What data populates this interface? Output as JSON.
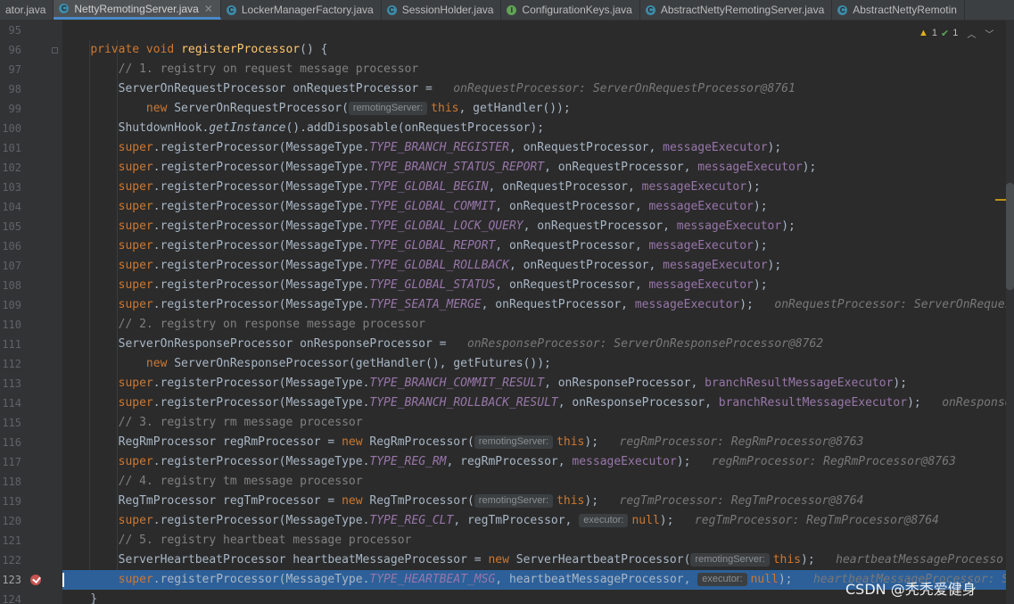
{
  "tabs": [
    {
      "label": "ator.java",
      "icon": "none",
      "close": false
    },
    {
      "label": "NettyRemotingServer.java",
      "icon": "class",
      "close": true,
      "active": true
    },
    {
      "label": "LockerManagerFactory.java",
      "icon": "class",
      "close": false
    },
    {
      "label": "SessionHolder.java",
      "icon": "class",
      "close": false
    },
    {
      "label": "ConfigurationKeys.java",
      "icon": "interface",
      "close": false
    },
    {
      "label": "AbstractNettyRemotingServer.java",
      "icon": "class",
      "close": false
    },
    {
      "label": "AbstractNettyRemotin",
      "icon": "class",
      "close": false
    }
  ],
  "inspection": {
    "warnings": "1",
    "ok": "1"
  },
  "current_line": "123",
  "watermark": "CSDN @秃秃爱健身",
  "colors": {
    "background": "#2b2b2b",
    "keyword": "#cc7832",
    "method": "#ffc66d",
    "constant": "#9876aa",
    "comment": "#808080",
    "selection": "#2d6099",
    "breakpoint": "#c75450"
  },
  "lines": [
    {
      "n": "95",
      "segs": []
    },
    {
      "n": "96",
      "segs": [
        [
          "    ",
          ""
        ],
        [
          "private void ",
          "kw"
        ],
        [
          "registerProcessor",
          "fn"
        ],
        [
          "() {",
          ""
        ]
      ],
      "fold": true
    },
    {
      "n": "97",
      "segs": [
        [
          "        ",
          ""
        ],
        [
          "// 1. registry on request message processor",
          "cm"
        ]
      ]
    },
    {
      "n": "98",
      "segs": [
        [
          "        ServerOnRequestProcessor onRequestProcessor = ",
          ""
        ],
        [
          "  onRequestProcessor: ServerOnRequestProcessor@8761",
          "hint"
        ]
      ]
    },
    {
      "n": "99",
      "segs": [
        [
          "            ",
          ""
        ],
        [
          "new ",
          "kw"
        ],
        [
          "ServerOnRequestProcessor(",
          ""
        ],
        [
          "remotingServer:",
          "chip"
        ],
        [
          "this",
          "kw"
        ],
        [
          ", getHandler());",
          ""
        ]
      ]
    },
    {
      "n": "100",
      "segs": [
        [
          "        ShutdownHook.",
          ""
        ],
        [
          "getInstance",
          "it"
        ],
        [
          "().addDisposable(onRequestProcessor);",
          ""
        ]
      ]
    },
    {
      "n": "101",
      "segs": [
        [
          "        ",
          ""
        ],
        [
          "super",
          "kw"
        ],
        [
          ".registerProcessor(MessageType.",
          ""
        ],
        [
          "TYPE_BRANCH_REGISTER",
          "st"
        ],
        [
          ", onRequestProcessor, ",
          ""
        ],
        [
          "messageExecutor",
          "va"
        ],
        [
          ");",
          ""
        ]
      ]
    },
    {
      "n": "102",
      "segs": [
        [
          "        ",
          ""
        ],
        [
          "super",
          "kw"
        ],
        [
          ".registerProcessor(MessageType.",
          ""
        ],
        [
          "TYPE_BRANCH_STATUS_REPORT",
          "st"
        ],
        [
          ", onRequestProcessor, ",
          ""
        ],
        [
          "messageExecutor",
          "va"
        ],
        [
          ");",
          ""
        ]
      ]
    },
    {
      "n": "103",
      "segs": [
        [
          "        ",
          ""
        ],
        [
          "super",
          "kw"
        ],
        [
          ".registerProcessor(MessageType.",
          ""
        ],
        [
          "TYPE_GLOBAL_BEGIN",
          "st"
        ],
        [
          ", onRequestProcessor, ",
          ""
        ],
        [
          "messageExecutor",
          "va"
        ],
        [
          ");",
          ""
        ]
      ]
    },
    {
      "n": "104",
      "segs": [
        [
          "        ",
          ""
        ],
        [
          "super",
          "kw"
        ],
        [
          ".registerProcessor(MessageType.",
          ""
        ],
        [
          "TYPE_GLOBAL_COMMIT",
          "st"
        ],
        [
          ", onRequestProcessor, ",
          ""
        ],
        [
          "messageExecutor",
          "va"
        ],
        [
          ");",
          ""
        ]
      ]
    },
    {
      "n": "105",
      "segs": [
        [
          "        ",
          ""
        ],
        [
          "super",
          "kw"
        ],
        [
          ".registerProcessor(MessageType.",
          ""
        ],
        [
          "TYPE_GLOBAL_LOCK_QUERY",
          "st"
        ],
        [
          ", onRequestProcessor, ",
          ""
        ],
        [
          "messageExecutor",
          "va"
        ],
        [
          ");",
          ""
        ]
      ]
    },
    {
      "n": "106",
      "segs": [
        [
          "        ",
          ""
        ],
        [
          "super",
          "kw"
        ],
        [
          ".registerProcessor(MessageType.",
          ""
        ],
        [
          "TYPE_GLOBAL_REPORT",
          "st"
        ],
        [
          ", onRequestProcessor, ",
          ""
        ],
        [
          "messageExecutor",
          "va"
        ],
        [
          ");",
          ""
        ]
      ]
    },
    {
      "n": "107",
      "segs": [
        [
          "        ",
          ""
        ],
        [
          "super",
          "kw"
        ],
        [
          ".registerProcessor(MessageType.",
          ""
        ],
        [
          "TYPE_GLOBAL_ROLLBACK",
          "st"
        ],
        [
          ", onRequestProcessor, ",
          ""
        ],
        [
          "messageExecutor",
          "va"
        ],
        [
          ");",
          ""
        ]
      ]
    },
    {
      "n": "108",
      "segs": [
        [
          "        ",
          ""
        ],
        [
          "super",
          "kw"
        ],
        [
          ".registerProcessor(MessageType.",
          ""
        ],
        [
          "TYPE_GLOBAL_STATUS",
          "st"
        ],
        [
          ", onRequestProcessor, ",
          ""
        ],
        [
          "messageExecutor",
          "va"
        ],
        [
          ");",
          ""
        ]
      ]
    },
    {
      "n": "109",
      "segs": [
        [
          "        ",
          ""
        ],
        [
          "super",
          "kw"
        ],
        [
          ".registerProcessor(MessageType.",
          ""
        ],
        [
          "TYPE_SEATA_MERGE",
          "st"
        ],
        [
          ", onRequestProcessor, ",
          ""
        ],
        [
          "messageExecutor",
          "va"
        ],
        [
          ");",
          ""
        ],
        [
          "   onRequestProcessor: ServerOnReques",
          "hint"
        ]
      ]
    },
    {
      "n": "110",
      "segs": [
        [
          "        ",
          ""
        ],
        [
          "// 2. registry on response message processor",
          "cm"
        ]
      ]
    },
    {
      "n": "111",
      "segs": [
        [
          "        ServerOnResponseProcessor onResponseProcessor = ",
          ""
        ],
        [
          "  onResponseProcessor: ServerOnResponseProcessor@8762",
          "hint"
        ]
      ]
    },
    {
      "n": "112",
      "segs": [
        [
          "            ",
          ""
        ],
        [
          "new ",
          "kw"
        ],
        [
          "ServerOnResponseProcessor(getHandler(), getFutures());",
          ""
        ]
      ]
    },
    {
      "n": "113",
      "segs": [
        [
          "        ",
          ""
        ],
        [
          "super",
          "kw"
        ],
        [
          ".registerProcessor(MessageType.",
          ""
        ],
        [
          "TYPE_BRANCH_COMMIT_RESULT",
          "st"
        ],
        [
          ", onResponseProcessor, ",
          ""
        ],
        [
          "branchResultMessageExecutor",
          "va"
        ],
        [
          ");",
          ""
        ]
      ]
    },
    {
      "n": "114",
      "segs": [
        [
          "        ",
          ""
        ],
        [
          "super",
          "kw"
        ],
        [
          ".registerProcessor(MessageType.",
          ""
        ],
        [
          "TYPE_BRANCH_ROLLBACK_RESULT",
          "st"
        ],
        [
          ", onResponseProcessor, ",
          ""
        ],
        [
          "branchResultMessageExecutor",
          "va"
        ],
        [
          ");",
          ""
        ],
        [
          "   onResponseI",
          "hint"
        ]
      ]
    },
    {
      "n": "115",
      "segs": [
        [
          "        ",
          ""
        ],
        [
          "// 3. registry rm message processor",
          "cm"
        ]
      ]
    },
    {
      "n": "116",
      "segs": [
        [
          "        RegRmProcessor regRmProcessor = ",
          ""
        ],
        [
          "new ",
          "kw"
        ],
        [
          "RegRmProcessor(",
          ""
        ],
        [
          "remotingServer:",
          "chip"
        ],
        [
          "this",
          "kw"
        ],
        [
          ");",
          ""
        ],
        [
          "   regRmProcessor: RegRmProcessor@8763",
          "hint"
        ]
      ]
    },
    {
      "n": "117",
      "segs": [
        [
          "        ",
          ""
        ],
        [
          "super",
          "kw"
        ],
        [
          ".registerProcessor(MessageType.",
          ""
        ],
        [
          "TYPE_REG_RM",
          "st"
        ],
        [
          ", regRmProcessor, ",
          ""
        ],
        [
          "messageExecutor",
          "va"
        ],
        [
          ");",
          ""
        ],
        [
          "   regRmProcessor: RegRmProcessor@8763",
          "hint"
        ]
      ]
    },
    {
      "n": "118",
      "segs": [
        [
          "        ",
          ""
        ],
        [
          "// 4. registry tm message processor",
          "cm"
        ]
      ]
    },
    {
      "n": "119",
      "segs": [
        [
          "        RegTmProcessor regTmProcessor = ",
          ""
        ],
        [
          "new ",
          "kw"
        ],
        [
          "RegTmProcessor(",
          ""
        ],
        [
          "remotingServer:",
          "chip"
        ],
        [
          "this",
          "kw"
        ],
        [
          ");",
          ""
        ],
        [
          "   regTmProcessor: RegTmProcessor@8764",
          "hint"
        ]
      ]
    },
    {
      "n": "120",
      "segs": [
        [
          "        ",
          ""
        ],
        [
          "super",
          "kw"
        ],
        [
          ".registerProcessor(MessageType.",
          ""
        ],
        [
          "TYPE_REG_CLT",
          "st"
        ],
        [
          ", regTmProcessor, ",
          ""
        ],
        [
          "executor:",
          "chip"
        ],
        [
          "null",
          "kw"
        ],
        [
          ");",
          ""
        ],
        [
          "   regTmProcessor: RegTmProcessor@8764",
          "hint"
        ]
      ]
    },
    {
      "n": "121",
      "segs": [
        [
          "        ",
          ""
        ],
        [
          "// 5. registry heartbeat message processor",
          "cm"
        ]
      ]
    },
    {
      "n": "122",
      "segs": [
        [
          "        ServerHeartbeatProcessor heartbeatMessageProcessor = ",
          ""
        ],
        [
          "new ",
          "kw"
        ],
        [
          "ServerHeartbeatProcessor(",
          ""
        ],
        [
          "remotingServer:",
          "chip"
        ],
        [
          "this",
          "kw"
        ],
        [
          ");",
          ""
        ],
        [
          "   heartbeatMessageProcesso",
          "hint"
        ]
      ]
    },
    {
      "n": "123",
      "segs": [
        [
          "        ",
          ""
        ],
        [
          "super",
          "kw"
        ],
        [
          ".registerProcessor(MessageType.",
          ""
        ],
        [
          "TYPE_HEARTBEAT_MSG",
          "st"
        ],
        [
          ", heartbeatMessageProcessor, ",
          ""
        ],
        [
          "executor:",
          "chip"
        ],
        [
          "null",
          "kw"
        ],
        [
          ");",
          ""
        ],
        [
          "   heartbeatMessageProcessor: S",
          "hint"
        ]
      ],
      "current": true,
      "breakpoint": true
    },
    {
      "n": "124",
      "segs": [
        [
          "    }",
          ""
        ]
      ]
    }
  ]
}
